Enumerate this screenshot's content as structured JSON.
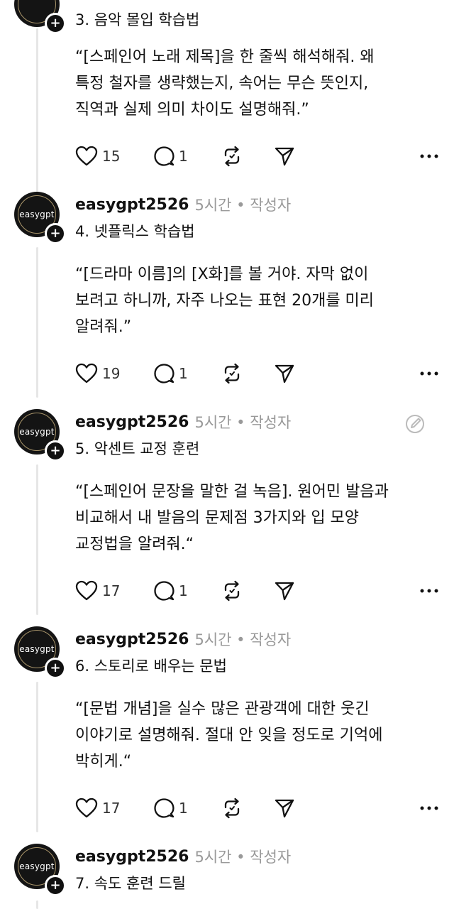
{
  "posts": [
    {
      "show_header": false,
      "title": "3. 음악 몰입 학습법",
      "lines": [
        "“[스페인어 노래 제목]을 한 줄씩 해석해줘. 왜",
        "특정 철자를 생략했는지, 속어는 무슨 뜻인지,",
        "직역과 실제 의미 차이도 설명해줘.”"
      ],
      "likes": "15",
      "comments": "1"
    },
    {
      "show_header": true,
      "username": "easygpt2526",
      "meta": "5시간 • 작성자",
      "avatar_text": "easygpt",
      "title": "4. 넷플릭스 학습법",
      "lines": [
        "“[드라마 이름]의 [X화]를 볼 거야. 자막 없이",
        "보려고 하니까, 자주 나오는 표현 20개를 미리",
        "알려줘.”"
      ],
      "likes": "19",
      "comments": "1"
    },
    {
      "show_header": true,
      "username": "easygpt2526",
      "meta": "5시간 • 작성자",
      "avatar_text": "easygpt",
      "title": "5. 악센트 교정 훈련",
      "lines": [
        "“[스페인어 문장을 말한 걸 녹음]. 원어민 발음과",
        "비교해서 내 발음의 문제점 3가지와 입 모양",
        "교정법을 알려줘.“"
      ],
      "likes": "17",
      "comments": "1"
    },
    {
      "show_header": true,
      "username": "easygpt2526",
      "meta": "5시간 • 작성자",
      "avatar_text": "easygpt",
      "title": "6. 스토리로 배우는 문법",
      "lines": [
        "“[문법 개념]을 실수 많은 관광객에 대한 웃긴",
        "이야기로 설명해줘. 절대 안 잊을 정도로 기억에",
        "박히게.“"
      ],
      "likes": "17",
      "comments": "1"
    },
    {
      "show_header": true,
      "username": "easygpt2526",
      "meta": "5시간 • 작성자",
      "avatar_text": "easygpt",
      "title": "7. 속도 훈련 드릴",
      "lines": [],
      "likes": "",
      "comments": ""
    }
  ],
  "icons": {
    "like": "heart-icon",
    "comment": "comment-bubble-icon",
    "repost": "repost-icon",
    "share": "share-send-icon",
    "more": "more-dots-icon",
    "edit": "edit-icon",
    "follow": "plus-icon"
  },
  "colors": {
    "text": "#111111",
    "meta": "#999999",
    "thread_line": "#e6e6e6",
    "avatar_ring": "#a8946a"
  }
}
